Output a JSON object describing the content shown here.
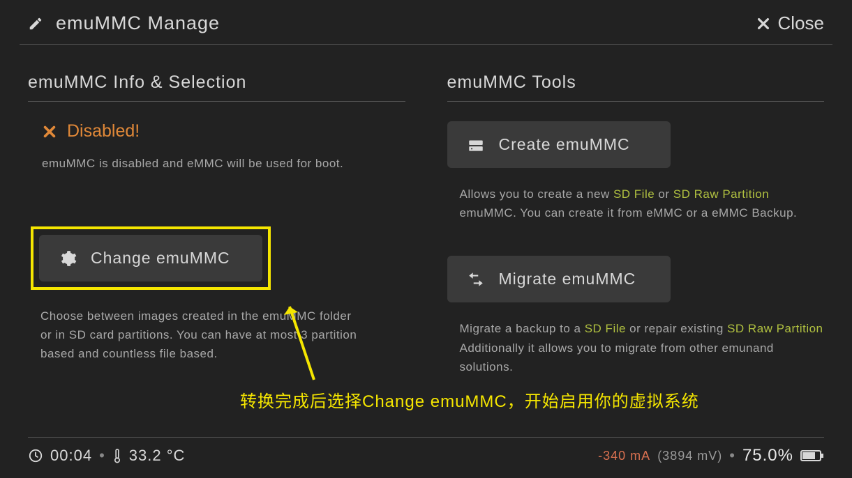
{
  "header": {
    "title": "emuMMC Manage",
    "close_label": "Close"
  },
  "left": {
    "section_title": "emuMMC Info & Selection",
    "status_label": "Disabled!",
    "status_desc": "emuMMC is disabled and eMMC will be used for boot.",
    "change_btn": "Change emuMMC",
    "change_desc_1": "Choose between images created in the emuMMC folder",
    "change_desc_2": "or in SD card partitions. You can have at most 3 partition",
    "change_desc_3": "based and countless file based."
  },
  "right": {
    "section_title": "emuMMC Tools",
    "create_btn": "Create emuMMC",
    "create_desc_pre": "Allows you to create a new ",
    "create_desc_sd": "SD File",
    "create_desc_or": " or ",
    "create_desc_raw": "SD Raw Partition",
    "create_desc_line2": "emuMMC. You can create it from eMMC or a eMMC Backup.",
    "migrate_btn": "Migrate emuMMC",
    "migrate_desc_pre": "Migrate a backup to a ",
    "migrate_desc_sd": "SD File",
    "migrate_desc_mid": " or repair existing ",
    "migrate_desc_raw": "SD Raw Partition",
    "migrate_desc_line2": "Additionally it allows you to migrate from other emunand",
    "migrate_desc_line3": "solutions."
  },
  "annotation": "转换完成后选择Change emuMMC，开始启用你的虚拟系统",
  "footer": {
    "time": "00:04",
    "temp": "33.2 °C",
    "current": "-340 mA",
    "voltage": "(3894 mV)",
    "battery": "75.0%"
  }
}
